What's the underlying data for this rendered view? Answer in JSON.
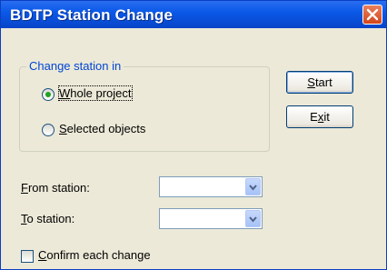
{
  "window": {
    "title": "BDTP Station Change"
  },
  "group": {
    "legend": "Change station in",
    "options": [
      {
        "label_first": "W",
        "label_rest": "hole project",
        "selected": true
      },
      {
        "label_first": "S",
        "label_rest": "elected objects",
        "selected": false
      }
    ]
  },
  "buttons": {
    "start": {
      "first": "S",
      "rest": "tart"
    },
    "exit": {
      "pre": "E",
      "u": "x",
      "post": "it"
    }
  },
  "fields": {
    "from": {
      "first": "F",
      "rest": "rom station:",
      "value": ""
    },
    "to": {
      "first": "T",
      "rest": "o station:",
      "value": ""
    }
  },
  "confirm": {
    "first": "C",
    "rest": "onfirm each change",
    "checked": false
  },
  "colors": {
    "title_bar": "#0b59e8",
    "legend": "#0046d5",
    "radio_selected": "#21a121",
    "close": "#d3461a"
  }
}
